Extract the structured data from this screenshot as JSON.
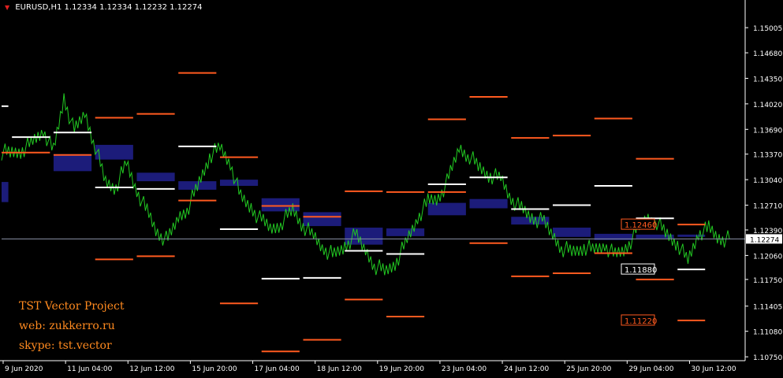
{
  "header": {
    "symbol": "EURUSD,H1",
    "ohlc": "1.12334 1.12334 1.12232 1.12274"
  },
  "watermark": {
    "line1": "TST Vector Project",
    "line2": "web: zukkerro.ru",
    "line3": "skype: tst.vector"
  },
  "colors": {
    "background": "#000000",
    "candles": "#22c922",
    "axis": "#ffffff",
    "upper_level": "#ff5a1f",
    "lower_level": "#ffffff",
    "zone": "#1c1c7a",
    "price_line": "#8a93a8"
  },
  "chart_data": {
    "type": "line",
    "title": "EURUSD,H1",
    "y_ticks": [
      "1.15005",
      "1.14680",
      "1.14350",
      "1.14020",
      "1.13690",
      "1.13370",
      "1.13040",
      "1.12710",
      "1.12390",
      "1.12060",
      "1.11750",
      "1.11405",
      "1.11080",
      "1.10750"
    ],
    "x_ticks": [
      "9 Jun 2020",
      "11 Jun 04:00",
      "12 Jun 12:00",
      "15 Jun 20:00",
      "17 Jun 04:00",
      "18 Jun 12:00",
      "19 Jun 20:00",
      "23 Jun 04:00",
      "24 Jun 12:00",
      "25 Jun 20:00",
      "29 Jun 04:00",
      "30 Jun 12:00"
    ],
    "current_price": "1.12274",
    "level_labels": [
      {
        "price": "1.12460",
        "kind": "upper"
      },
      {
        "price": "1.11880",
        "kind": "lower"
      },
      {
        "price": "1.11220",
        "kind": "upper"
      }
    ],
    "price_series": [
      {
        "x": 0,
        "y": 1.134
      },
      {
        "x": 2,
        "y": 1.1338
      },
      {
        "x": 4,
        "y": 1.1343
      },
      {
        "x": 6,
        "y": 1.1352
      },
      {
        "x": 8,
        "y": 1.1368
      },
      {
        "x": 10,
        "y": 1.134
      },
      {
        "x": 12,
        "y": 1.141
      },
      {
        "x": 14,
        "y": 1.1365
      },
      {
        "x": 16,
        "y": 1.139
      },
      {
        "x": 18,
        "y": 1.1348
      },
      {
        "x": 20,
        "y": 1.13
      },
      {
        "x": 22,
        "y": 1.1295
      },
      {
        "x": 24,
        "y": 1.1325
      },
      {
        "x": 26,
        "y": 1.129
      },
      {
        "x": 28,
        "y": 1.1262
      },
      {
        "x": 30,
        "y": 1.1235
      },
      {
        "x": 32,
        "y": 1.1225
      },
      {
        "x": 34,
        "y": 1.1255
      },
      {
        "x": 36,
        "y": 1.127
      },
      {
        "x": 38,
        "y": 1.13
      },
      {
        "x": 40,
        "y": 1.1335
      },
      {
        "x": 42,
        "y": 1.1345
      },
      {
        "x": 44,
        "y": 1.1325
      },
      {
        "x": 46,
        "y": 1.128
      },
      {
        "x": 48,
        "y": 1.1268
      },
      {
        "x": 50,
        "y": 1.125
      },
      {
        "x": 52,
        "y": 1.124
      },
      {
        "x": 54,
        "y": 1.125
      },
      {
        "x": 56,
        "y": 1.1265
      },
      {
        "x": 58,
        "y": 1.1245
      },
      {
        "x": 60,
        "y": 1.123
      },
      {
        "x": 62,
        "y": 1.1215
      },
      {
        "x": 64,
        "y": 1.1205
      },
      {
        "x": 66,
        "y": 1.1218
      },
      {
        "x": 68,
        "y": 1.1232
      },
      {
        "x": 70,
        "y": 1.1212
      },
      {
        "x": 72,
        "y": 1.1192
      },
      {
        "x": 74,
        "y": 1.1185
      },
      {
        "x": 76,
        "y": 1.12
      },
      {
        "x": 78,
        "y": 1.1225
      },
      {
        "x": 80,
        "y": 1.1255
      },
      {
        "x": 82,
        "y": 1.1275
      },
      {
        "x": 84,
        "y": 1.128
      },
      {
        "x": 86,
        "y": 1.1305
      },
      {
        "x": 88,
        "y": 1.1345
      },
      {
        "x": 90,
        "y": 1.1335
      },
      {
        "x": 92,
        "y": 1.1318
      },
      {
        "x": 94,
        "y": 1.131
      },
      {
        "x": 96,
        "y": 1.1305
      },
      {
        "x": 98,
        "y": 1.128
      },
      {
        "x": 100,
        "y": 1.1265
      },
      {
        "x": 102,
        "y": 1.1255
      },
      {
        "x": 104,
        "y": 1.125
      },
      {
        "x": 106,
        "y": 1.1232
      },
      {
        "x": 108,
        "y": 1.1215
      },
      {
        "x": 110,
        "y": 1.121
      },
      {
        "x": 112,
        "y": 1.1218
      },
      {
        "x": 114,
        "y": 1.1212
      },
      {
        "x": 116,
        "y": 1.122
      },
      {
        "x": 118,
        "y": 1.1205
      },
      {
        "x": 120,
        "y": 1.1215
      },
      {
        "x": 122,
        "y": 1.1235
      },
      {
        "x": 124,
        "y": 1.1255
      },
      {
        "x": 126,
        "y": 1.125
      },
      {
        "x": 128,
        "y": 1.1232
      },
      {
        "x": 130,
        "y": 1.1222
      },
      {
        "x": 132,
        "y": 1.1198
      },
      {
        "x": 134,
        "y": 1.1235
      },
      {
        "x": 136,
        "y": 1.124
      },
      {
        "x": 138,
        "y": 1.1228
      },
      {
        "x": 140,
        "y": 1.1227
      }
    ],
    "levels": [
      {
        "x0": 0,
        "x1": 1,
        "y": 1.1399,
        "kind": "lower"
      },
      {
        "x0": 2,
        "x1": 9,
        "y": 1.1359,
        "kind": "lower"
      },
      {
        "x0": 10,
        "x1": 17,
        "y": 1.1365,
        "kind": "lower"
      },
      {
        "x0": 0,
        "x1": 9,
        "y": 1.1339,
        "kind": "upper"
      },
      {
        "x0": 10,
        "x1": 17,
        "y": 1.1336,
        "kind": "upper"
      },
      {
        "x0": 18,
        "x1": 25,
        "y": 1.1384,
        "kind": "upper"
      },
      {
        "x0": 26,
        "x1": 33,
        "y": 1.1389,
        "kind": "upper"
      },
      {
        "x0": 34,
        "x1": 41,
        "y": 1.1442,
        "kind": "upper"
      },
      {
        "x0": 42,
        "x1": 49,
        "y": 1.1333,
        "kind": "upper"
      },
      {
        "x0": 18,
        "x1": 25,
        "y": 1.1294,
        "kind": "lower"
      },
      {
        "x0": 26,
        "x1": 33,
        "y": 1.1292,
        "kind": "lower"
      },
      {
        "x0": 34,
        "x1": 41,
        "y": 1.1347,
        "kind": "lower"
      },
      {
        "x0": 42,
        "x1": 49,
        "y": 1.124,
        "kind": "lower"
      },
      {
        "x0": 18,
        "x1": 25,
        "y": 1.1201,
        "kind": "upper"
      },
      {
        "x0": 26,
        "x1": 33,
        "y": 1.1205,
        "kind": "upper"
      },
      {
        "x0": 34,
        "x1": 41,
        "y": 1.1277,
        "kind": "upper"
      },
      {
        "x0": 42,
        "x1": 49,
        "y": 1.1144,
        "kind": "upper"
      },
      {
        "x0": 50,
        "x1": 57,
        "y": 1.127,
        "kind": "upper"
      },
      {
        "x0": 58,
        "x1": 65,
        "y": 1.1256,
        "kind": "upper"
      },
      {
        "x0": 66,
        "x1": 73,
        "y": 1.1289,
        "kind": "upper"
      },
      {
        "x0": 74,
        "x1": 81,
        "y": 1.1288,
        "kind": "upper"
      },
      {
        "x0": 50,
        "x1": 57,
        "y": 1.1082,
        "kind": "upper"
      },
      {
        "x0": 58,
        "x1": 65,
        "y": 1.1097,
        "kind": "upper"
      },
      {
        "x0": 66,
        "x1": 73,
        "y": 1.1149,
        "kind": "upper"
      },
      {
        "x0": 74,
        "x1": 81,
        "y": 1.1127,
        "kind": "upper"
      },
      {
        "x0": 50,
        "x1": 57,
        "y": 1.1176,
        "kind": "lower"
      },
      {
        "x0": 58,
        "x1": 65,
        "y": 1.1177,
        "kind": "lower"
      },
      {
        "x0": 66,
        "x1": 73,
        "y": 1.1212,
        "kind": "lower"
      },
      {
        "x0": 74,
        "x1": 81,
        "y": 1.1208,
        "kind": "lower"
      },
      {
        "x0": 82,
        "x1": 89,
        "y": 1.1298,
        "kind": "lower"
      },
      {
        "x0": 90,
        "x1": 97,
        "y": 1.1307,
        "kind": "lower"
      },
      {
        "x0": 98,
        "x1": 105,
        "y": 1.1266,
        "kind": "lower"
      },
      {
        "x0": 106,
        "x1": 113,
        "y": 1.1271,
        "kind": "lower"
      },
      {
        "x0": 114,
        "x1": 121,
        "y": 1.1296,
        "kind": "lower"
      },
      {
        "x0": 122,
        "x1": 129,
        "y": 1.1254,
        "kind": "lower"
      },
      {
        "x0": 130,
        "x1": 135,
        "y": 1.1188,
        "kind": "lower"
      },
      {
        "x0": 82,
        "x1": 89,
        "y": 1.1382,
        "kind": "upper"
      },
      {
        "x0": 90,
        "x1": 97,
        "y": 1.1411,
        "kind": "upper"
      },
      {
        "x0": 98,
        "x1": 105,
        "y": 1.1358,
        "kind": "upper"
      },
      {
        "x0": 106,
        "x1": 113,
        "y": 1.1361,
        "kind": "upper"
      },
      {
        "x0": 114,
        "x1": 121,
        "y": 1.1383,
        "kind": "upper"
      },
      {
        "x0": 122,
        "x1": 129,
        "y": 1.1331,
        "kind": "upper"
      },
      {
        "x0": 130,
        "x1": 135,
        "y": 1.1246,
        "kind": "upper"
      },
      {
        "x0": 82,
        "x1": 89,
        "y": 1.1288,
        "kind": "upper"
      },
      {
        "x0": 90,
        "x1": 97,
        "y": 1.1222,
        "kind": "upper"
      },
      {
        "x0": 98,
        "x1": 105,
        "y": 1.1179,
        "kind": "upper"
      },
      {
        "x0": 106,
        "x1": 113,
        "y": 1.1183,
        "kind": "upper"
      },
      {
        "x0": 114,
        "x1": 121,
        "y": 1.1209,
        "kind": "upper"
      },
      {
        "x0": 122,
        "x1": 129,
        "y": 1.1175,
        "kind": "upper"
      },
      {
        "x0": 130,
        "x1": 135,
        "y": 1.1122,
        "kind": "upper"
      }
    ],
    "zones": [
      {
        "x0": 0,
        "x1": 1,
        "y_top": 1.1301,
        "y_bot": 1.1275
      },
      {
        "x0": 10,
        "x1": 17,
        "y_top": 1.1337,
        "y_bot": 1.1315
      },
      {
        "x0": 18,
        "x1": 25,
        "y_top": 1.1349,
        "y_bot": 1.133
      },
      {
        "x0": 26,
        "x1": 33,
        "y_top": 1.1313,
        "y_bot": 1.1302
      },
      {
        "x0": 34,
        "x1": 41,
        "y_top": 1.1302,
        "y_bot": 1.1291
      },
      {
        "x0": 42,
        "x1": 49,
        "y_top": 1.1304,
        "y_bot": 1.1296
      },
      {
        "x0": 50,
        "x1": 57,
        "y_top": 1.128,
        "y_bot": 1.1263
      },
      {
        "x0": 58,
        "x1": 65,
        "y_top": 1.1262,
        "y_bot": 1.1244
      },
      {
        "x0": 66,
        "x1": 73,
        "y_top": 1.1242,
        "y_bot": 1.122
      },
      {
        "x0": 74,
        "x1": 81,
        "y_top": 1.1241,
        "y_bot": 1.1231
      },
      {
        "x0": 82,
        "x1": 89,
        "y_top": 1.1274,
        "y_bot": 1.1258
      },
      {
        "x0": 90,
        "x1": 97,
        "y_top": 1.1279,
        "y_bot": 1.1267
      },
      {
        "x0": 98,
        "x1": 105,
        "y_top": 1.1256,
        "y_bot": 1.1246
      },
      {
        "x0": 106,
        "x1": 113,
        "y_top": 1.1242,
        "y_bot": 1.123
      },
      {
        "x0": 114,
        "x1": 121,
        "y_top": 1.1234,
        "y_bot": 1.1226
      },
      {
        "x0": 122,
        "x1": 129,
        "y_top": 1.1233,
        "y_bot": 1.1228
      },
      {
        "x0": 130,
        "x1": 135,
        "y_top": 1.1233,
        "y_bot": 1.123
      }
    ],
    "x_domain": [
      0,
      143
    ],
    "y_domain": [
      1.107,
      1.1522
    ]
  }
}
